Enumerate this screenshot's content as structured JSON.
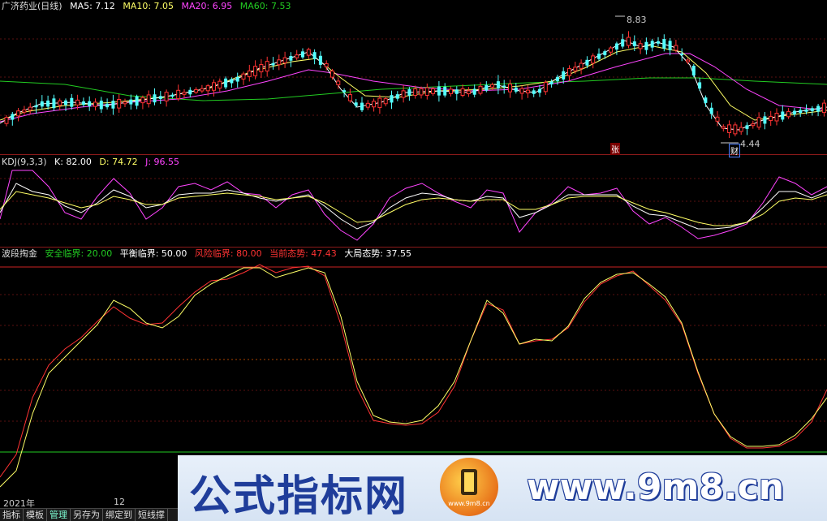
{
  "main_panel": {
    "stock_name": "广济药业(日线)",
    "ma5": "MA5: 7.12",
    "ma10": "MA10: 7.05",
    "ma20": "MA20: 6.95",
    "ma60": "MA60: 7.53",
    "high_label": "8.83",
    "low_label": "4.44",
    "mark_zhang": "张",
    "mark_cai": "财",
    "colors": {
      "ma5": "#ffffff",
      "ma10": "#ffff66",
      "ma20": "#ff44ff",
      "ma60": "#22cc22",
      "up": "#ff3333",
      "down": "#54ffff"
    }
  },
  "kdj_panel": {
    "title": "KDJ(9,3,3)",
    "k": "K: 82.00",
    "d": "D: 74.72",
    "j": "J: 96.55"
  },
  "wave_panel": {
    "title": "波段掏金",
    "safe": "安全临界: 20.00",
    "balance": "平衡临界: 50.00",
    "risk": "风险临界: 80.00",
    "current": "当前态势: 47.43",
    "overall": "大局态势: 37.55"
  },
  "date_bar": {
    "year": "2021年",
    "month": "12"
  },
  "tabs": [
    "指标",
    "模板",
    "管理",
    "另存为",
    "绑定到",
    "短线撑"
  ],
  "watermark": {
    "title": "公式指标网",
    "url": "www.9m8.cn",
    "logo_text": "www.9m8.cn"
  }
}
